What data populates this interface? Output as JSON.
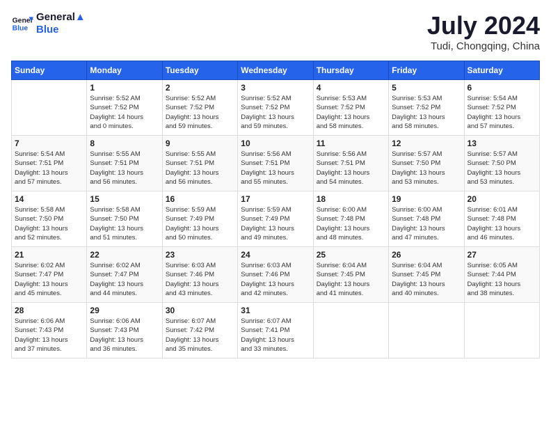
{
  "header": {
    "logo_line1": "General",
    "logo_line2": "Blue",
    "month": "July 2024",
    "location": "Tudi, Chongqing, China"
  },
  "columns": [
    "Sunday",
    "Monday",
    "Tuesday",
    "Wednesday",
    "Thursday",
    "Friday",
    "Saturday"
  ],
  "weeks": [
    [
      {
        "day": "",
        "info": ""
      },
      {
        "day": "1",
        "info": "Sunrise: 5:52 AM\nSunset: 7:52 PM\nDaylight: 14 hours\nand 0 minutes."
      },
      {
        "day": "2",
        "info": "Sunrise: 5:52 AM\nSunset: 7:52 PM\nDaylight: 13 hours\nand 59 minutes."
      },
      {
        "day": "3",
        "info": "Sunrise: 5:52 AM\nSunset: 7:52 PM\nDaylight: 13 hours\nand 59 minutes."
      },
      {
        "day": "4",
        "info": "Sunrise: 5:53 AM\nSunset: 7:52 PM\nDaylight: 13 hours\nand 58 minutes."
      },
      {
        "day": "5",
        "info": "Sunrise: 5:53 AM\nSunset: 7:52 PM\nDaylight: 13 hours\nand 58 minutes."
      },
      {
        "day": "6",
        "info": "Sunrise: 5:54 AM\nSunset: 7:52 PM\nDaylight: 13 hours\nand 57 minutes."
      }
    ],
    [
      {
        "day": "7",
        "info": "Sunrise: 5:54 AM\nSunset: 7:51 PM\nDaylight: 13 hours\nand 57 minutes."
      },
      {
        "day": "8",
        "info": "Sunrise: 5:55 AM\nSunset: 7:51 PM\nDaylight: 13 hours\nand 56 minutes."
      },
      {
        "day": "9",
        "info": "Sunrise: 5:55 AM\nSunset: 7:51 PM\nDaylight: 13 hours\nand 56 minutes."
      },
      {
        "day": "10",
        "info": "Sunrise: 5:56 AM\nSunset: 7:51 PM\nDaylight: 13 hours\nand 55 minutes."
      },
      {
        "day": "11",
        "info": "Sunrise: 5:56 AM\nSunset: 7:51 PM\nDaylight: 13 hours\nand 54 minutes."
      },
      {
        "day": "12",
        "info": "Sunrise: 5:57 AM\nSunset: 7:50 PM\nDaylight: 13 hours\nand 53 minutes."
      },
      {
        "day": "13",
        "info": "Sunrise: 5:57 AM\nSunset: 7:50 PM\nDaylight: 13 hours\nand 53 minutes."
      }
    ],
    [
      {
        "day": "14",
        "info": "Sunrise: 5:58 AM\nSunset: 7:50 PM\nDaylight: 13 hours\nand 52 minutes."
      },
      {
        "day": "15",
        "info": "Sunrise: 5:58 AM\nSunset: 7:50 PM\nDaylight: 13 hours\nand 51 minutes."
      },
      {
        "day": "16",
        "info": "Sunrise: 5:59 AM\nSunset: 7:49 PM\nDaylight: 13 hours\nand 50 minutes."
      },
      {
        "day": "17",
        "info": "Sunrise: 5:59 AM\nSunset: 7:49 PM\nDaylight: 13 hours\nand 49 minutes."
      },
      {
        "day": "18",
        "info": "Sunrise: 6:00 AM\nSunset: 7:48 PM\nDaylight: 13 hours\nand 48 minutes."
      },
      {
        "day": "19",
        "info": "Sunrise: 6:00 AM\nSunset: 7:48 PM\nDaylight: 13 hours\nand 47 minutes."
      },
      {
        "day": "20",
        "info": "Sunrise: 6:01 AM\nSunset: 7:48 PM\nDaylight: 13 hours\nand 46 minutes."
      }
    ],
    [
      {
        "day": "21",
        "info": "Sunrise: 6:02 AM\nSunset: 7:47 PM\nDaylight: 13 hours\nand 45 minutes."
      },
      {
        "day": "22",
        "info": "Sunrise: 6:02 AM\nSunset: 7:47 PM\nDaylight: 13 hours\nand 44 minutes."
      },
      {
        "day": "23",
        "info": "Sunrise: 6:03 AM\nSunset: 7:46 PM\nDaylight: 13 hours\nand 43 minutes."
      },
      {
        "day": "24",
        "info": "Sunrise: 6:03 AM\nSunset: 7:46 PM\nDaylight: 13 hours\nand 42 minutes."
      },
      {
        "day": "25",
        "info": "Sunrise: 6:04 AM\nSunset: 7:45 PM\nDaylight: 13 hours\nand 41 minutes."
      },
      {
        "day": "26",
        "info": "Sunrise: 6:04 AM\nSunset: 7:45 PM\nDaylight: 13 hours\nand 40 minutes."
      },
      {
        "day": "27",
        "info": "Sunrise: 6:05 AM\nSunset: 7:44 PM\nDaylight: 13 hours\nand 38 minutes."
      }
    ],
    [
      {
        "day": "28",
        "info": "Sunrise: 6:06 AM\nSunset: 7:43 PM\nDaylight: 13 hours\nand 37 minutes."
      },
      {
        "day": "29",
        "info": "Sunrise: 6:06 AM\nSunset: 7:43 PM\nDaylight: 13 hours\nand 36 minutes."
      },
      {
        "day": "30",
        "info": "Sunrise: 6:07 AM\nSunset: 7:42 PM\nDaylight: 13 hours\nand 35 minutes."
      },
      {
        "day": "31",
        "info": "Sunrise: 6:07 AM\nSunset: 7:41 PM\nDaylight: 13 hours\nand 33 minutes."
      },
      {
        "day": "",
        "info": ""
      },
      {
        "day": "",
        "info": ""
      },
      {
        "day": "",
        "info": ""
      }
    ]
  ]
}
